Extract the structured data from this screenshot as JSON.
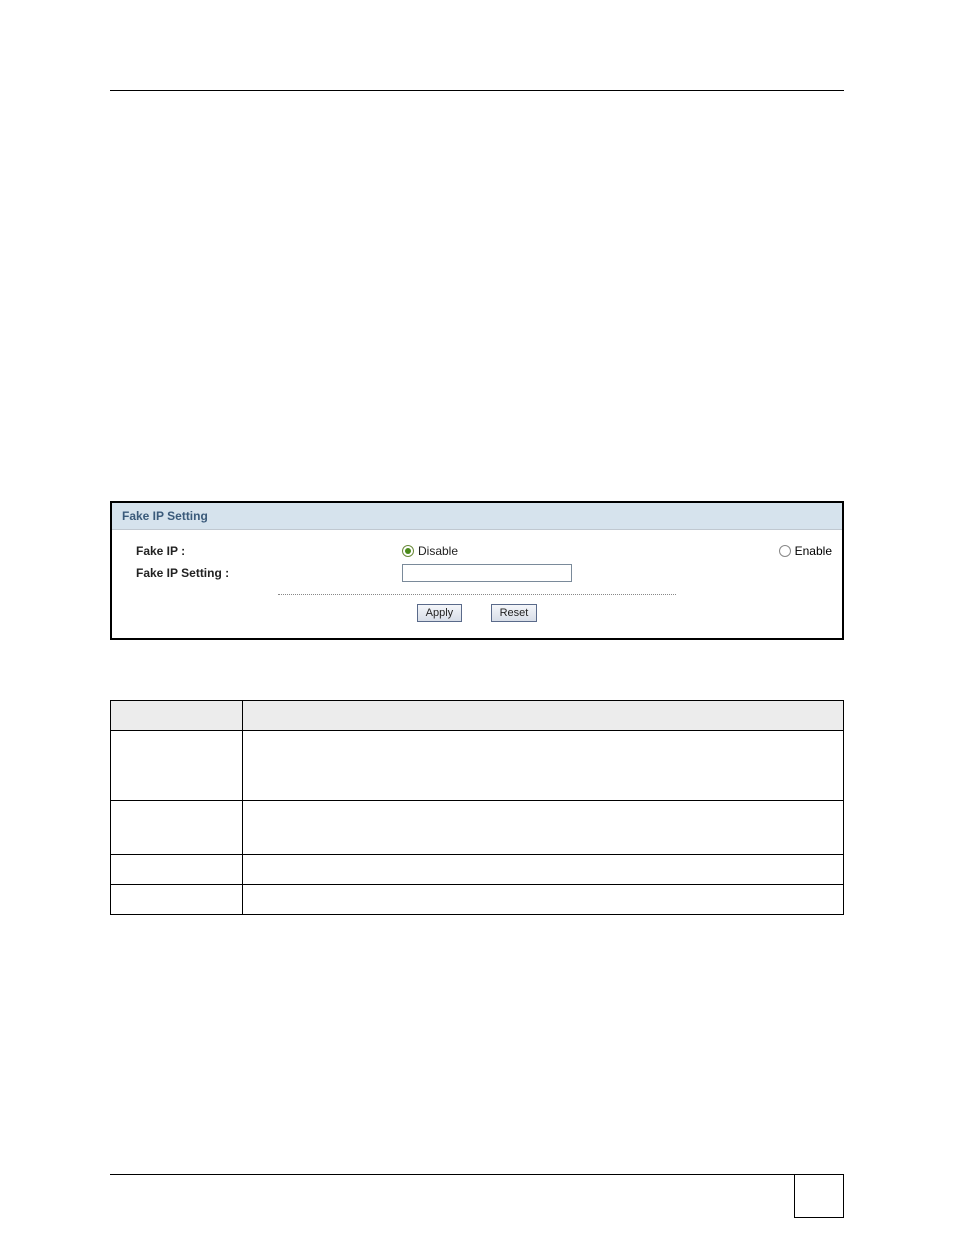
{
  "panel": {
    "title": "Fake IP Setting",
    "rows": {
      "fake_ip_label": "Fake IP :",
      "fake_ip_setting_label": "Fake IP Setting :"
    },
    "radios": {
      "disable": "Disable",
      "enable": "Enable",
      "selected": "disable"
    },
    "input_value": "",
    "buttons": {
      "apply": "Apply",
      "reset": "Reset"
    }
  },
  "desc_table": {
    "headers": {
      "item": "",
      "desc": ""
    },
    "rows": [
      {
        "item": "",
        "desc": ""
      },
      {
        "item": "",
        "desc": ""
      },
      {
        "item": "",
        "desc": ""
      },
      {
        "item": "",
        "desc": ""
      }
    ]
  },
  "page_number": ""
}
